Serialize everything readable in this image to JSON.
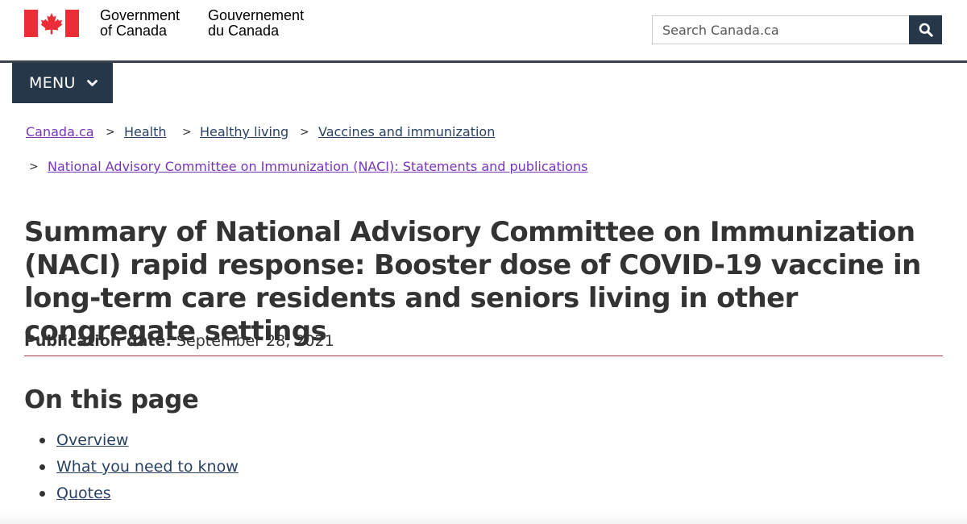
{
  "header": {
    "signature_en": "Government\nof Canada",
    "signature_fr": "Gouvernement\ndu Canada",
    "search_placeholder": "Search Canada.ca",
    "colors": {
      "flag_red": "#eb2d37",
      "header_rule": "#38414d",
      "search_button": "#26374a"
    },
    "search_icon": "magnifier-icon",
    "flag_icon": "canada-flag-icon"
  },
  "menu": {
    "label": "MENU",
    "icon": "chevron-down-icon",
    "color": "#26374a"
  },
  "breadcrumb": {
    "separator": ">",
    "items": [
      {
        "label": "Canada.ca",
        "visited": true
      },
      {
        "label": "Health",
        "visited": false
      },
      {
        "label": "Healthy living",
        "visited": false
      },
      {
        "label": "Vaccines and immunization",
        "visited": false
      },
      {
        "label": "National Advisory Committee on Immunization (NACI): Statements and publications",
        "visited": true
      }
    ],
    "link_color": "#284162",
    "visited_color": "#7834bc"
  },
  "main": {
    "title": "Summary of National Advisory Committee on Immunization (NACI) rapid response: Booster dose of COVID-19 vaccine in long-term care residents and seniors living in other congregate settings",
    "title_rule_color": "#af3c43",
    "publication_label": "Publication date:",
    "publication_date": "September 28, 2021",
    "toc_heading": "On this page",
    "toc_items": [
      {
        "label": "Overview"
      },
      {
        "label": "What you need to know"
      },
      {
        "label": "Quotes"
      }
    ]
  }
}
